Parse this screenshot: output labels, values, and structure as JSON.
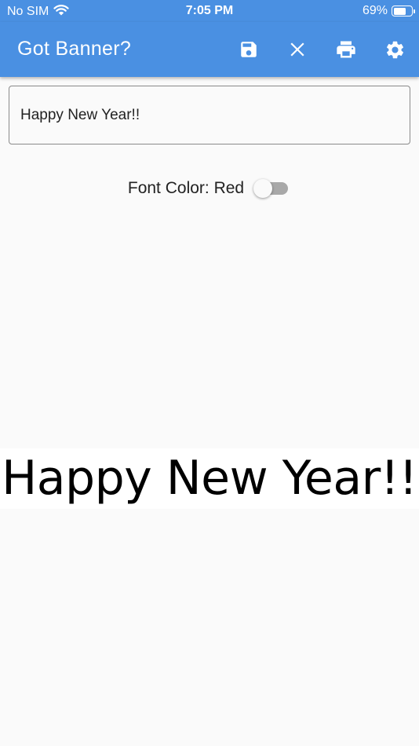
{
  "status_bar": {
    "carrier": "No SIM",
    "time": "7:05 PM",
    "battery_percent": "69%",
    "battery_level": 0.69
  },
  "app_bar": {
    "title": "Got Banner?",
    "color": "#4a90e2",
    "actions": [
      {
        "name": "save",
        "icon": "save-icon"
      },
      {
        "name": "clear",
        "icon": "close-icon"
      },
      {
        "name": "print",
        "icon": "print-icon"
      },
      {
        "name": "settings",
        "icon": "gear-icon"
      }
    ]
  },
  "banner_input": {
    "value": "Happy New Year!!"
  },
  "font_color_toggle": {
    "label": "Font Color: Red",
    "checked": false
  },
  "banner_preview": {
    "text": "Happy New Year!!",
    "font_color": "#000000"
  }
}
